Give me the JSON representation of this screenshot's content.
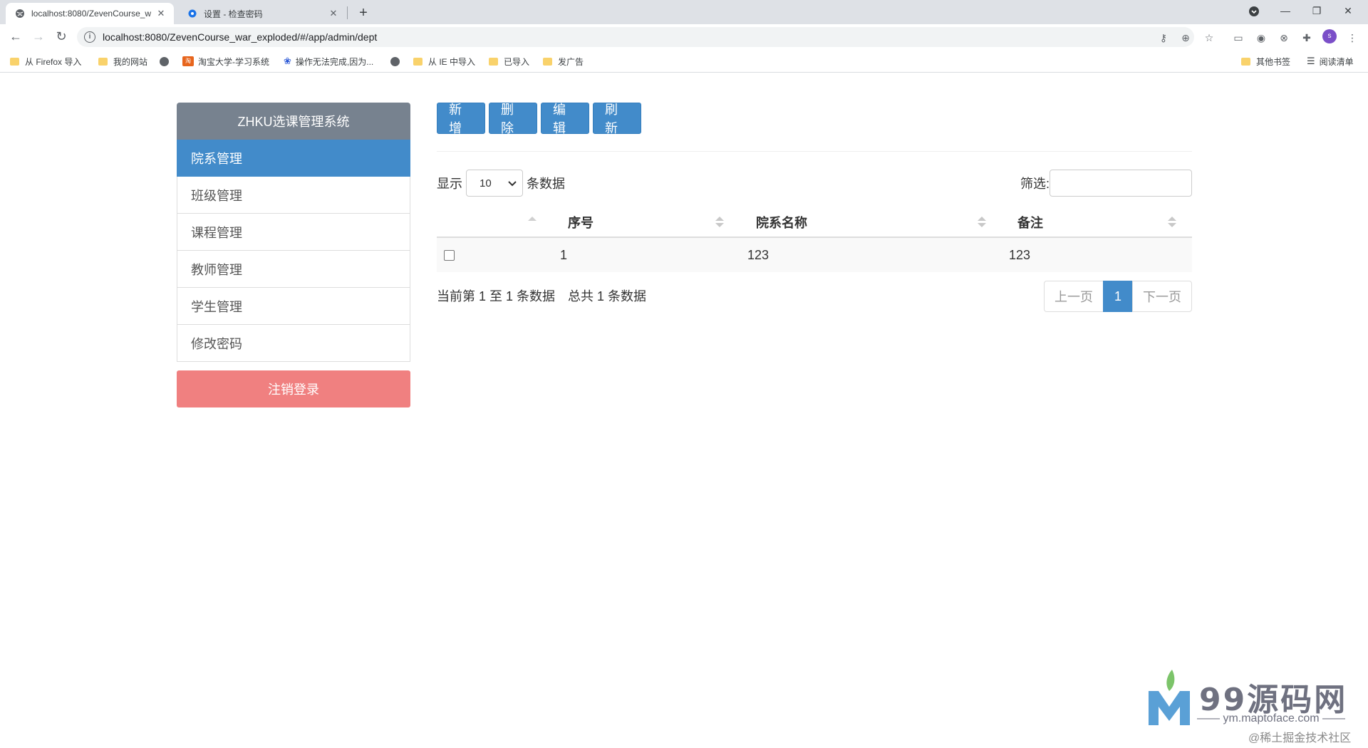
{
  "browser": {
    "tabs": [
      {
        "title": "localhost:8080/ZevenCourse_w",
        "active": true
      },
      {
        "title": "设置 - 检查密码",
        "active": false
      }
    ],
    "url": "localhost:8080/ZevenCourse_war_exploded/#/app/admin/dept",
    "bookmarks": [
      "从 Firefox 导入",
      "我的网站",
      "淘宝大学-学习系统",
      "操作无法完成,因为...",
      "从 IE 中导入",
      "已导入",
      "发广告"
    ],
    "bookmarks_right": [
      "其他书签",
      "阅读清单"
    ],
    "profile_initial": "s"
  },
  "sidebar": {
    "title": "ZHKU选课管理系统",
    "items": [
      {
        "label": "院系管理",
        "active": true
      },
      {
        "label": "班级管理",
        "active": false
      },
      {
        "label": "课程管理",
        "active": false
      },
      {
        "label": "教师管理",
        "active": false
      },
      {
        "label": "学生管理",
        "active": false
      },
      {
        "label": "修改密码",
        "active": false
      }
    ],
    "logout_label": "注销登录"
  },
  "toolbar": {
    "add_label": "新增",
    "delete_label": "删除",
    "edit_label": "编辑",
    "refresh_label": "刷新"
  },
  "table_controls": {
    "show_label": "显示",
    "page_size": "10",
    "rows_label": "条数据",
    "filter_label": "筛选:"
  },
  "table": {
    "columns": [
      "序号",
      "院系名称",
      "备注"
    ],
    "rows": [
      {
        "index": "1",
        "name": "123",
        "remark": "123"
      }
    ]
  },
  "footer": {
    "info": "当前第 1 至 1 条数据　总共 1 条数据",
    "prev_label": "上一页",
    "current_page": "1",
    "next_label": "下一页"
  },
  "watermark": {
    "brand": "99源码网",
    "url": "—— ym.maptoface.com ——",
    "credit": "@稀土掘金技术社区"
  },
  "colors": {
    "primary": "#428bca",
    "sidebar_header": "#77828f",
    "logout": "#f08080"
  }
}
